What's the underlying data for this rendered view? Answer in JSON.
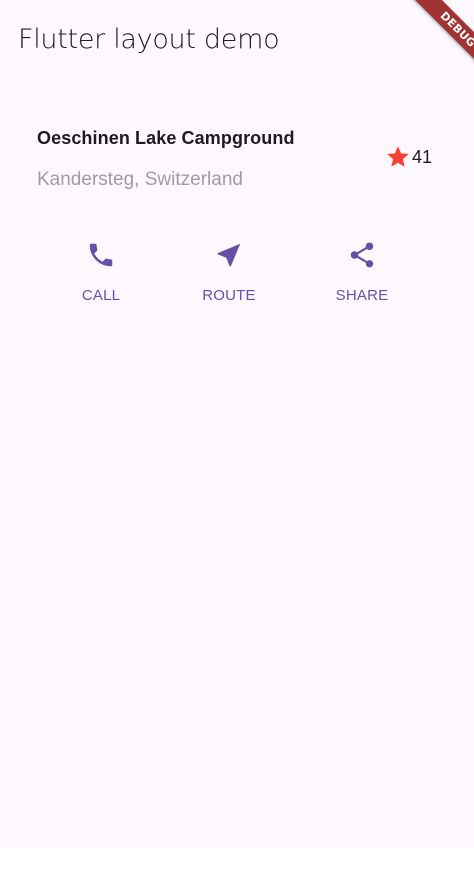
{
  "appbar": {
    "title": "Flutter layout demo"
  },
  "debug_banner": {
    "label": "DEBUG",
    "color": "#a03333"
  },
  "title_section": {
    "name": "Oeschinen Lake Campground",
    "location": "Kandersteg, Switzerland",
    "rating": {
      "icon": "star-icon",
      "icon_color": "#f44336",
      "count": "41"
    }
  },
  "actions": [
    {
      "icon": "phone-icon",
      "label": "CALL"
    },
    {
      "icon": "navigation-icon",
      "label": "ROUTE"
    },
    {
      "icon": "share-icon",
      "label": "SHARE"
    }
  ],
  "colors": {
    "background": "#fdf7fe",
    "accent": "#6750a4",
    "secondary_text": "#9e9e9e"
  }
}
